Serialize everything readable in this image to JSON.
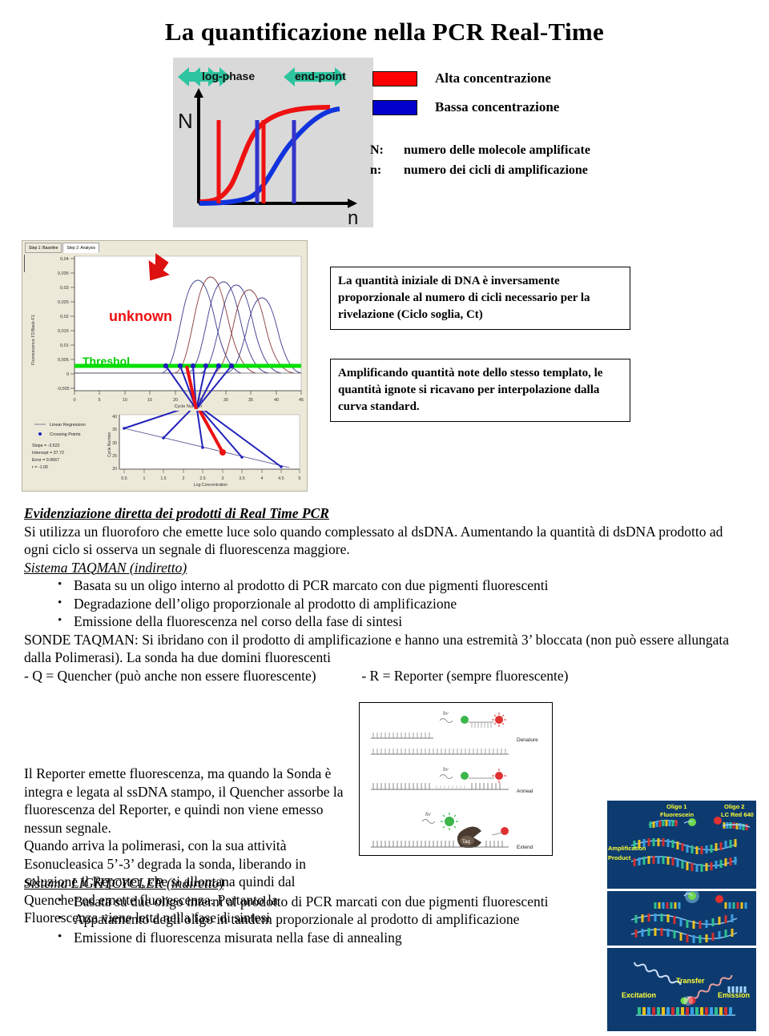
{
  "title": "La quantificazione nella  PCR  Real-Time",
  "top_figure": {
    "label_log_phase": "log-phase",
    "label_end_point": "end-point",
    "y_axis": "N",
    "x_axis": "n",
    "curve_high_color": "#ee1111",
    "curve_low_color": "#1133dd",
    "arrow_color": "#2ec4a0",
    "background": "#d9d9d9"
  },
  "legend": {
    "items": [
      {
        "color": "#ff0000",
        "label": "Alta concentrazione"
      },
      {
        "color": "#0000cc",
        "label": "Bassa concentrazione"
      }
    ],
    "definitions": [
      {
        "key": "N:",
        "value": "numero delle molecole amplificate"
      },
      {
        "key": "n:",
        "value": "numero dei cicli di amplificazione"
      }
    ]
  },
  "software_panel": {
    "tabs": [
      {
        "label": "Step 1: Baseline",
        "active": false
      },
      {
        "label": "Step 2: Analysis",
        "active": true
      }
    ],
    "annotation_unknown": "unknown",
    "annotation_threshold": "Threshol",
    "amplification_chart": {
      "y_axis_label": "Fluorescence F2/Back-F1",
      "x_axis_label": "Cycle Number",
      "y_ticks": [
        "0,04",
        "0,035",
        "0,03",
        "0,025",
        "0,02",
        "0,015",
        "0,01",
        "0,005",
        "0",
        "-0,005"
      ],
      "x_ticks": [
        "0",
        "5",
        "10",
        "15",
        "20",
        "25",
        "30",
        "35",
        "40",
        "45"
      ],
      "threshold_color": "#00e000",
      "crossing_point_color": "#2222bb"
    },
    "standard_curve": {
      "y_axis_label": "Cycle Number",
      "x_axis_label": "Log Concentration",
      "y_ticks": [
        "40",
        "35",
        "30",
        "25",
        "20"
      ],
      "x_ticks": [
        "0.5",
        "1",
        "1.5",
        "2",
        "2.5",
        "3",
        "3.5",
        "4",
        "4.5",
        "5"
      ],
      "legend": [
        "Linear Regression",
        "Crossing Points"
      ],
      "stats": [
        "Slope = -3.522",
        "Intercept = 37.72",
        "Error = 0.0667",
        "r = -1.00"
      ]
    }
  },
  "callouts": [
    "La quantità  iniziale di DNA è inversamente proporzionale al numero di cicli necessario per la rivelazione (Ciclo soglia, Ct)",
    "Amplificando quantità note dello stesso templato, le quantità ignote si ricavano per interpolazione dalla curva standard."
  ],
  "body": {
    "heading1": "Evidenziazione diretta dei prodotti di Real Time PCR",
    "para1": "Si utilizza un fluoroforo che emette luce solo quando complessato al dsDNA. Aumentando la quantità di dsDNA prodotto ad ogni ciclo si osserva un segnale di fluorescenza maggiore.",
    "heading2": "Sistema TAQMAN (indiretto)",
    "bullets1": [
      "Basata su un oligo interno al prodotto di PCR marcato con due pigmenti fluorescenti",
      "Degradazione dell’oligo proporzionale al prodotto di amplificazione",
      "Emissione della fluorescenza nel corso della fase di sintesi"
    ],
    "para2": "SONDE TAQMAN: Si ibridano con il prodotto di amplificazione e hanno una estremità 3’ bloccata (non può essere allungata dalla Polimerasi). La sonda ha due domini fluorescenti",
    "para3_left": "- Q = Quencher (può anche non essere fluorescente)",
    "para3_right": "- R = Reporter (sempre fluorescente)",
    "para4": "Il Reporter emette fluorescenza, ma quando la Sonda è integra e legata al ssDNA stampo, il Quencher assorbe la fluorescenza del Reporter, e quindi non viene emesso nessun segnale.",
    "para5": "Quando arriva la polimerasi, con la sua attività Esonucleasica 5’-3’ degrada la sonda, liberando in soluzione il Reporter, che si allontana quindi dal Quencher ed emette fluorescenza. Pertanto la Fluorescenza viene letta nella fase di sintesi",
    "heading3": "Sistema LIGHTCYCLER (indiretto)",
    "bullets2": [
      "Basata su due oligo interni al prodotto di PCR marcati con due pigmenti fluorescenti",
      "Appaiamento degli oligo in tandem proporzionale al prodotto di amplificazione",
      "Emissione di fluorescenza misurata nella fase di annealing"
    ]
  },
  "taqman_figure": {
    "steps": [
      "Denature",
      "Anneal",
      "Extend"
    ],
    "photon_symbol": "hv",
    "enzyme_label": "Taq",
    "reporter_color": "#3cb54a",
    "quencher_color": "#e03030"
  },
  "lightcycler_figures": {
    "panel1": {
      "oligo1": "Oligo 1",
      "oligo1_dye": "Fluorescein",
      "oligo2": "Oligo 2",
      "oligo2_dye": "LC Red 640",
      "product": "Amplification Product"
    },
    "panel3": {
      "excitation": "Excitation",
      "transfer": "Transfer",
      "emission": "Emission"
    }
  }
}
